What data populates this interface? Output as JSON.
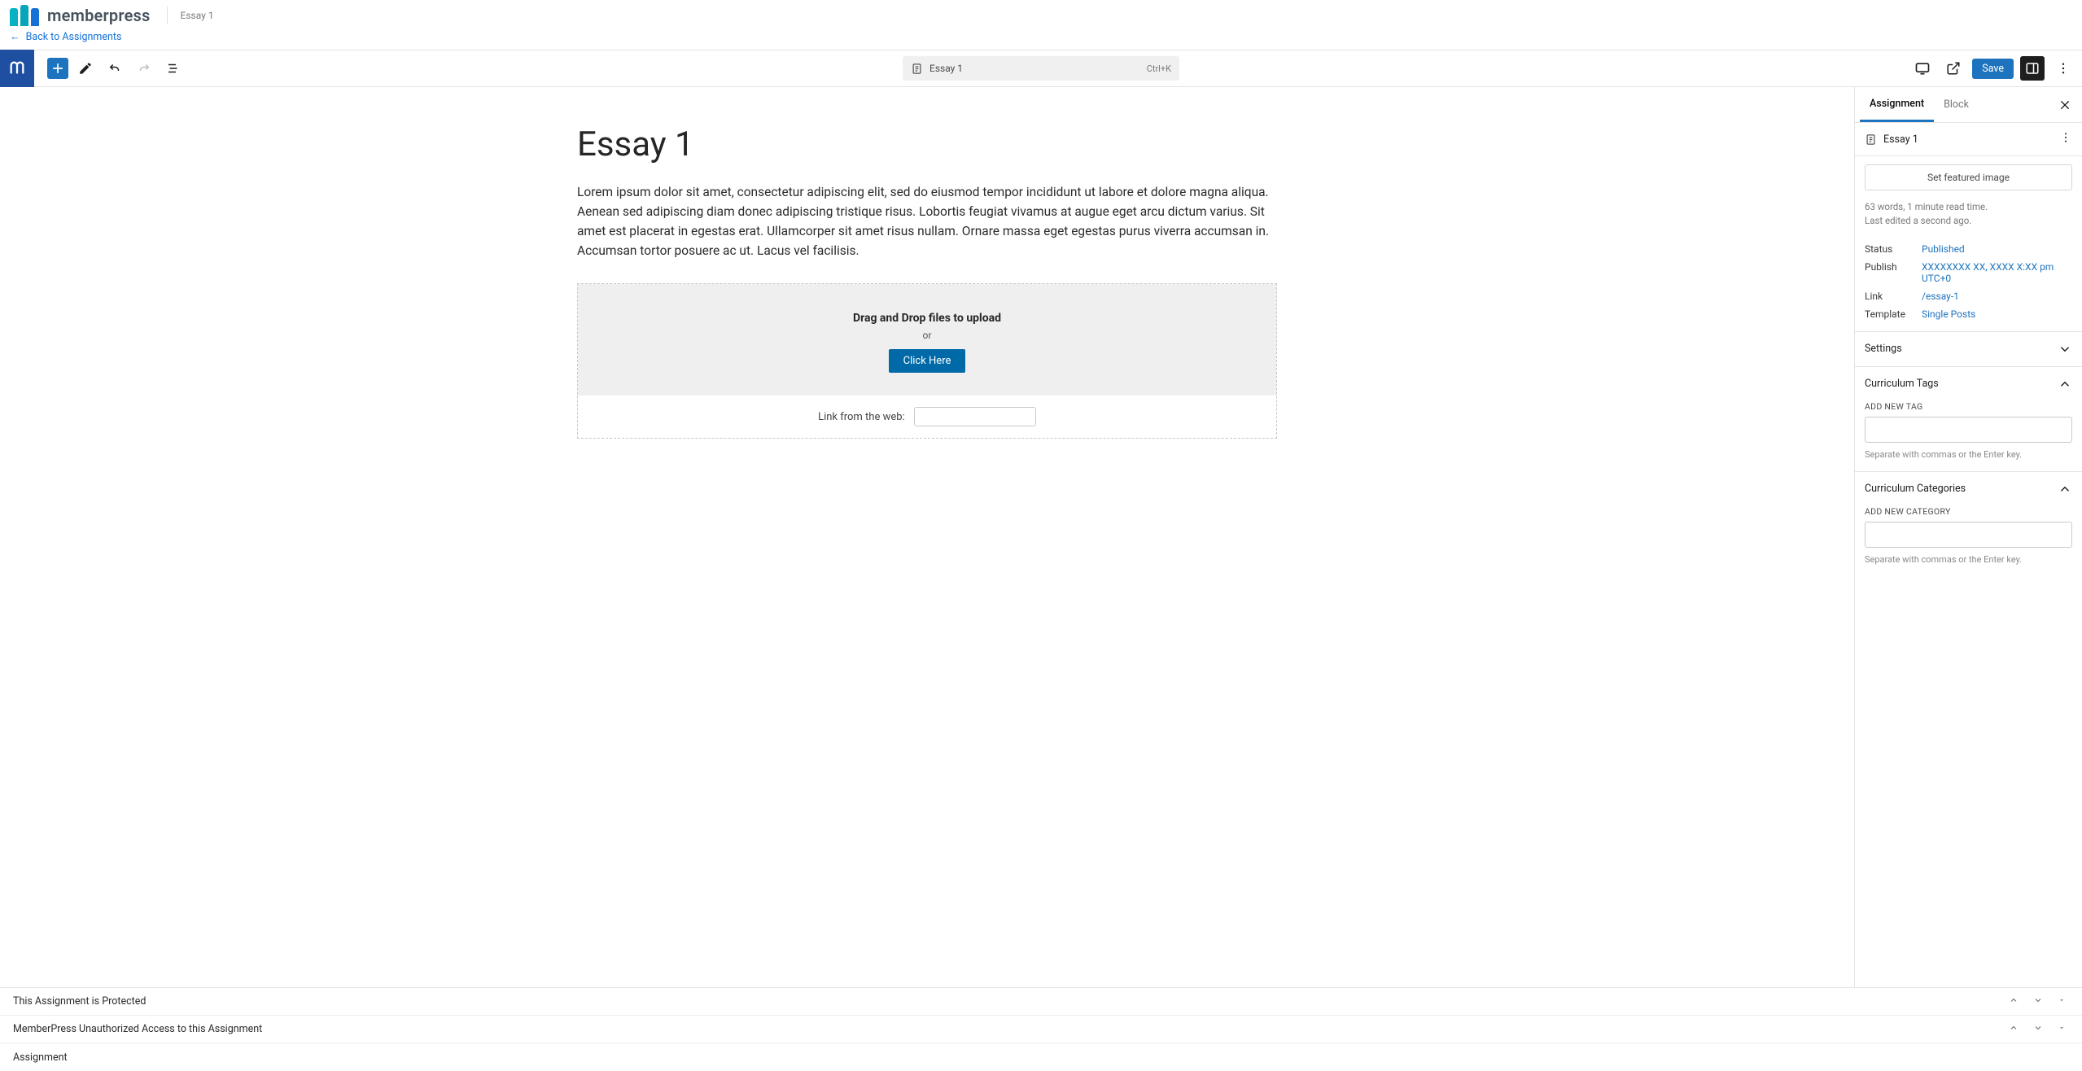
{
  "brand": {
    "name": "memberpress",
    "doc_title": "Essay 1"
  },
  "back_link": "Back to Assignments",
  "toolbar": {
    "cmd_hint": "Ctrl+K",
    "doc_label": "Essay 1",
    "save_label": "Save"
  },
  "post": {
    "title": "Essay 1",
    "body": "Lorem ipsum dolor sit amet, consectetur adipiscing elit, sed do eiusmod tempor incididunt ut labore et dolore magna aliqua. Aenean sed adipiscing diam donec adipiscing tristique risus. Lobortis feugiat vivamus at augue eget arcu dictum varius. Sit amet est placerat in egestas erat. Ullamcorper sit amet risus nullam. Ornare massa eget egestas purus viverra accumsan in. Accumsan tortor posuere ac ut. Lacus vel facilisis.",
    "upload": {
      "dragdrop": "Drag and Drop files to upload",
      "or": "or",
      "button": "Click Here",
      "link_label": "Link from the web:"
    }
  },
  "sidebar": {
    "tabs": {
      "assignment": "Assignment",
      "block": "Block"
    },
    "summary_name": "Essay 1",
    "featured_label": "Set featured image",
    "stats_line1": "63 words, 1 minute read time.",
    "stats_line2": "Last edited a second ago.",
    "kv": {
      "status_k": "Status",
      "status_v": "Published",
      "publish_k": "Publish",
      "publish_v": "XXXXXXXX XX, XXXX X:XX pm UTC+0",
      "link_k": "Link",
      "link_v": "/essay-1",
      "template_k": "Template",
      "template_v": "Single Posts"
    },
    "sections": {
      "settings": "Settings",
      "tags": "Curriculum Tags",
      "tags_label": "ADD NEW TAG",
      "tags_hint": "Separate with commas or the Enter key.",
      "cats": "Curriculum Categories",
      "cats_label": "ADD NEW CATEGORY",
      "cats_hint": "Separate with commas or the Enter key."
    }
  },
  "meta_boxes": [
    "This Assignment is Protected",
    "MemberPress Unauthorized Access to this Assignment",
    "Assignment"
  ]
}
